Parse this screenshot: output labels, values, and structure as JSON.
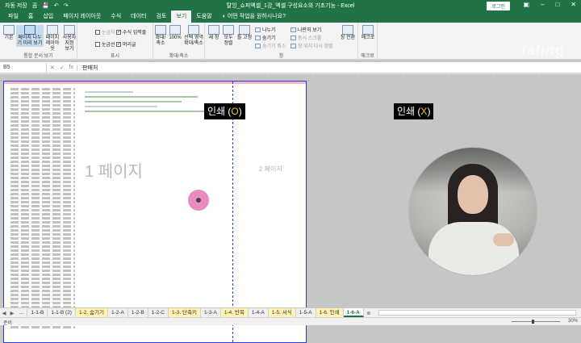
{
  "window": {
    "autosave_label": "자동 저장",
    "autosave_state": "끔",
    "title": "탈잉_쇼피엑셀_1강_엑셀 구성요소와 기초기능 - Excel",
    "login_label": "로그인"
  },
  "tabs": [
    "파일",
    "홈",
    "삽입",
    "페이지 레이아웃",
    "수식",
    "데이터",
    "검토",
    "보기",
    "도움말"
  ],
  "active_tab": "보기",
  "tell_me": "어떤 작업을 원하시나요?",
  "ribbon": {
    "views": {
      "buttons": [
        "기본",
        "페이지 나누기 미리 보기",
        "페이지 레이아웃",
        "사용자 지정 보기"
      ],
      "group_label": "통합 문서 보기"
    },
    "show": {
      "ruler": "눈금자",
      "formula_bar": "수식 입력줄",
      "gridlines": "눈금선",
      "headings": "머리글",
      "group_label": "표시"
    },
    "zoom": {
      "buttons": [
        "확대/축소",
        "100%",
        "선택 영역 확대/축소"
      ],
      "group_label": "확대/축소"
    },
    "window": {
      "buttons": [
        "새 창",
        "모두 정렬",
        "틀 고정"
      ],
      "split": "나누기",
      "hide": "숨기기",
      "unhide": "숨기기 취소",
      "side_by_side": "나란히 보기",
      "sync_scroll": "동시 스크롤",
      "reset_position": "창 위치 다시 정렬",
      "switch": "창 전환",
      "group_label": "창"
    },
    "macros": {
      "button": "매크로",
      "group_label": "매크로"
    }
  },
  "brand_watermark": "taling",
  "formula_bar": {
    "name_box": "B5",
    "value": "판매처"
  },
  "sheet": {
    "page1_label": "1 페이지",
    "page2_label": "2 페이지"
  },
  "captions": {
    "print_yes_prefix": "인쇄 (",
    "print_yes_mark": "O",
    "print_no_prefix": "인쇄 (",
    "print_no_mark": "X",
    "suffix": ")"
  },
  "sheet_tabs": [
    {
      "label": "...",
      "style": "plain"
    },
    {
      "label": "1-1-B",
      "style": "plain"
    },
    {
      "label": "1-1-B (2)",
      "style": "plain"
    },
    {
      "label": "1-2. 숨기기",
      "style": "yellow"
    },
    {
      "label": "1-2-A",
      "style": "plain"
    },
    {
      "label": "1-2-B",
      "style": "plain"
    },
    {
      "label": "1-2-C",
      "style": "plain"
    },
    {
      "label": "1-3. 단축키",
      "style": "yellow"
    },
    {
      "label": "1-3-A",
      "style": "plain"
    },
    {
      "label": "1-4. 반복",
      "style": "yellow"
    },
    {
      "label": "1-4-A",
      "style": "plain"
    },
    {
      "label": "1-5. 서식",
      "style": "yellow"
    },
    {
      "label": "1-5-A",
      "style": "plain"
    },
    {
      "label": "1-6. 인쇄",
      "style": "yellow"
    },
    {
      "label": "1-6-A",
      "style": "active"
    }
  ],
  "status": {
    "ready": "준비",
    "zoom": "30%"
  }
}
